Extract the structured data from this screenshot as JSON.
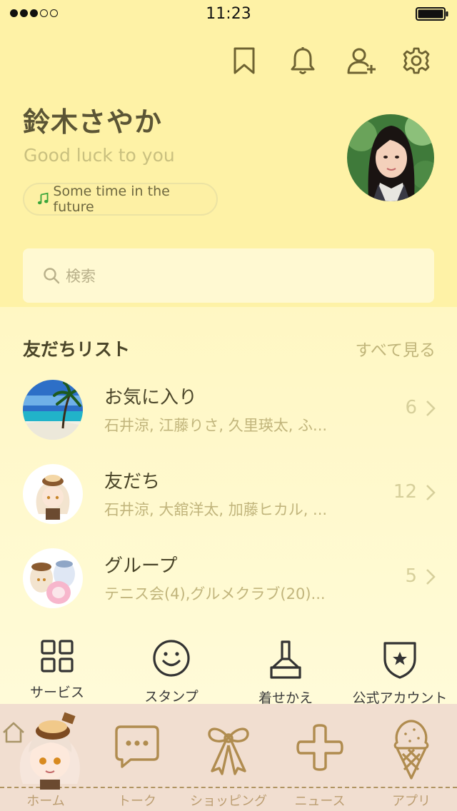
{
  "status_bar": {
    "time": "11:23",
    "signal_filled": 3,
    "signal_total": 5
  },
  "header_icons": [
    "bookmark-icon",
    "bell-icon",
    "add-friend-icon",
    "gear-icon"
  ],
  "profile": {
    "name": "鈴木さやか",
    "status_message": "Good luck to you",
    "music": "Some time in the future"
  },
  "search": {
    "placeholder": "検索"
  },
  "friends_list": {
    "title": "友だちリスト",
    "see_all": "すべて見る",
    "groups": [
      {
        "title": "お気に入り",
        "members": "石井涼, 江藤りさ, 久里瑛太, ふ...",
        "count": "6"
      },
      {
        "title": "友だち",
        "members": "石井涼, 大舘洋太, 加藤ヒカル, ...",
        "count": "12"
      },
      {
        "title": "グループ",
        "members": "テニス会(4),グルメクラブ(20)...",
        "count": "5"
      }
    ]
  },
  "services": [
    {
      "label": "サービス",
      "icon": "grid-icon"
    },
    {
      "label": "スタンプ",
      "icon": "smiley-icon"
    },
    {
      "label": "着せかえ",
      "icon": "brush-icon"
    },
    {
      "label": "公式アカウント",
      "icon": "shield-star-icon"
    }
  ],
  "tabs": [
    {
      "label": "ホーム",
      "icon": "home-icon"
    },
    {
      "label": "トーク",
      "icon": "chat-bubble-icon"
    },
    {
      "label": "ショッピング",
      "icon": "ribbon-icon"
    },
    {
      "label": "ニュース",
      "icon": "plus-icon"
    },
    {
      "label": "アプリ",
      "icon": "ice-cream-icon"
    }
  ],
  "colors": {
    "header_bg": "#fef2a6",
    "list_bg": "#fffbd9",
    "tabbar_bg": "#f1ded0",
    "accent": "#b08c4f"
  }
}
